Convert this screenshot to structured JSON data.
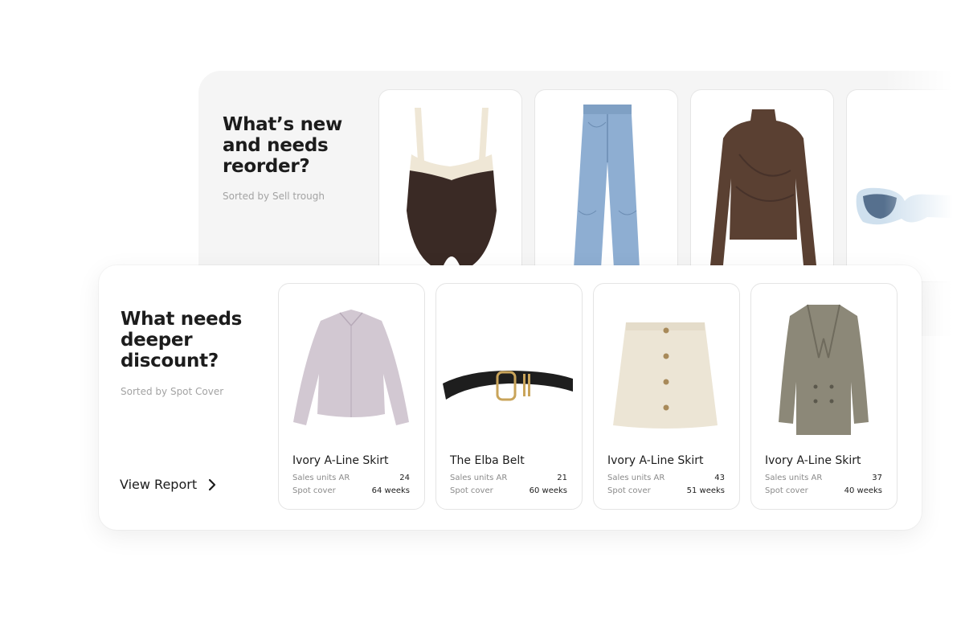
{
  "reorder_section": {
    "title": "What’s new and needs reorder?",
    "subtitle": "Sorted by Sell trough",
    "products": [
      {
        "image": "bodysuit-image"
      },
      {
        "image": "jeans-image"
      },
      {
        "image": "mesh-top-image"
      },
      {
        "image": "sunglasses-image"
      }
    ]
  },
  "discount_section": {
    "title": "What needs deeper discount?",
    "subtitle": "Sorted by Spot Cover",
    "view_report_label": "View Report",
    "products": [
      {
        "name": "Ivory A-Line Skirt",
        "sales_label": "Sales units AR",
        "sales_value": "24",
        "cover_label": "Spot cover",
        "cover_value": "64 weeks",
        "image": "shirt-image"
      },
      {
        "name": "The Elba Belt",
        "sales_label": "Sales units AR",
        "sales_value": "21",
        "cover_label": "Spot cover",
        "cover_value": "60 weeks",
        "image": "belt-image"
      },
      {
        "name": "Ivory A-Line Skirt",
        "sales_label": "Sales units AR",
        "sales_value": "43",
        "cover_label": "Spot cover",
        "cover_value": "51 weeks",
        "image": "skirt-image"
      },
      {
        "name": "Ivory A-Line Skirt",
        "sales_label": "Sales units AR",
        "sales_value": "37",
        "cover_label": "Spot cover",
        "cover_value": "40 weeks",
        "image": "blazer-image"
      }
    ]
  },
  "colors": {
    "panel_bg": "#f5f5f5",
    "card_border": "#e4e4e4",
    "text_primary": "#1c1c1c",
    "text_muted": "#a3a3a3"
  }
}
